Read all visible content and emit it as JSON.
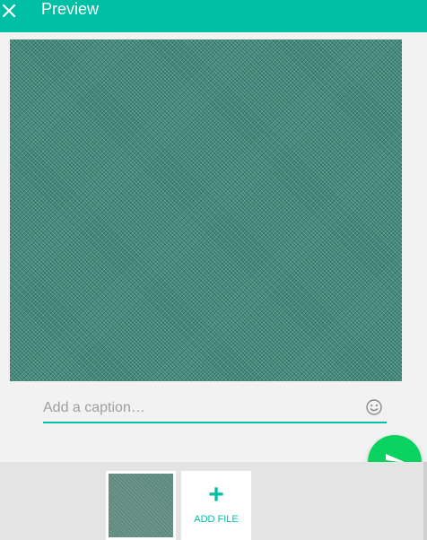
{
  "header": {
    "title": "Preview",
    "close_icon": "close-icon"
  },
  "caption": {
    "placeholder": "Add a caption…",
    "value": "",
    "emoji_icon": "smiley-icon"
  },
  "tray": {
    "add_file_symbol": "+",
    "add_file_label": "ADD FILE"
  },
  "send": {
    "icon": "send-icon"
  },
  "colors": {
    "accent": "#00bfa5",
    "send": "#09d261",
    "header_text": "#ffffff",
    "background": "#f2f2f2",
    "tray": "#e4e4e4"
  }
}
